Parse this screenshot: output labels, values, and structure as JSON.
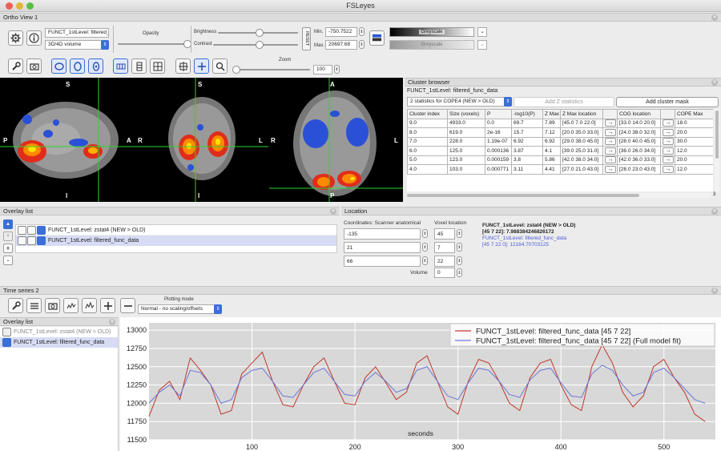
{
  "window": {
    "title": "FSLeyes"
  },
  "ortho": {
    "panel_title": "Ortho View 1",
    "overlay_name": "FUNCT_1stLevel: filtered_func_data",
    "overlay_type": "3D/4D volume",
    "opacity_label": "Opacity",
    "brightness_label": "Brightness",
    "contrast_label": "Contrast",
    "reset_label": "RESET",
    "min_label": "Min.",
    "max_label": "Max.",
    "min_value": "-750.7522",
    "max_value": "20697.68",
    "cmap1": "Greyscale",
    "cmap2": "Greyscale",
    "zoom_label": "Zoom",
    "zoom_value": "100",
    "labels": {
      "sag_top": "S",
      "sag_bottom": "I",
      "sag_left": "P",
      "sag_right": "A",
      "cor_top": "S",
      "cor_bottom": "I",
      "cor_left": "R",
      "cor_right": "L",
      "ax_top": "A",
      "ax_bottom": "P",
      "ax_left": "R",
      "ax_right": "L"
    }
  },
  "cluster": {
    "panel_title": "Cluster browser",
    "overlay_name": "FUNCT_1stLevel: filtered_func_data",
    "selector": "2 statistics for COPE4 (NEW > OLD)",
    "add_z_label": "Add Z statistics",
    "add_mask_label": "Add cluster mask",
    "columns": [
      "Cluster index",
      "Size (voxels)",
      "P",
      "-log10(P)",
      "Z Max",
      "Z Max location",
      "",
      "COG location",
      "",
      "COPE Max"
    ],
    "rows": [
      [
        "9.0",
        "4933.0",
        "0.0",
        "69.7",
        "7.89",
        "[45.0 7.0 22.0]",
        "→",
        "[33.0 14.0 20.0]",
        "→",
        "18.0"
      ],
      [
        "8.0",
        "619.0",
        "2e-16",
        "15.7",
        "7.12",
        "[20.0 35.0 33.0]",
        "→",
        "[24.0 38.0 32.0]",
        "→",
        "20.0"
      ],
      [
        "7.0",
        "228.0",
        "1.19e-07",
        "6.92",
        "6.92",
        "[29.0 38.0 45.0]",
        "→",
        "[28.0 40.0 45.0]",
        "→",
        "30.0"
      ],
      [
        "6.0",
        "125.0",
        "0.000136",
        "3.87",
        "4.1",
        "[39.0 25.0 31.0]",
        "→",
        "[36.0 26.0 34.0]",
        "→",
        "12.0"
      ],
      [
        "5.0",
        "123.0",
        "0.000159",
        "3.8",
        "5.86",
        "[42.0 38.0 34.0]",
        "→",
        "[42.0 36.0 33.0]",
        "→",
        "20.0"
      ],
      [
        "4.0",
        "103.0",
        "0.000771",
        "3.11",
        "4.41",
        "[27.0 21.0 43.0]",
        "→",
        "[28.0 23.0 43.0]",
        "→",
        "12.0"
      ]
    ],
    "scroll_suffix": "3"
  },
  "overlay_list": {
    "panel_title": "Overlay list",
    "items": [
      {
        "name": "FUNCT_1stLevel: zstat4 (NEW > OLD)"
      },
      {
        "name": "FUNCT_1stLevel: filtered_func_data"
      }
    ]
  },
  "location": {
    "panel_title": "Location",
    "coords_label": "Coordinates: Scanner anatomical",
    "voxel_label": "Voxel location",
    "coord_values": [
      "-135",
      "21",
      "66"
    ],
    "voxel_values": [
      "45",
      "7",
      "22"
    ],
    "volume_label": "Volume",
    "volume_value": "0",
    "info_line1": "FUNCT_1stLevel: zstat4 (NEW > OLD)",
    "info_line2": "[45 7 22]: 7.988384246826172",
    "info_line3": "FUNCT_1stLevel: filtered_func_data",
    "info_line4": "[45 7 22 0]: 12164.70703125"
  },
  "timeseries": {
    "panel_title": "Time series 2",
    "plotting_mode_label": "Plotting mode",
    "plotting_mode_value": "Normal - no scaling/offsets",
    "overlay_list_title": "Overlay list",
    "overlay_items": [
      {
        "name": "FUNCT_1stLevel: zstat4 (NEW > OLD)"
      },
      {
        "name": "FUNCT_1stLevel: filtered_func_data"
      }
    ]
  },
  "chart_data": {
    "type": "line",
    "xlabel": "seconds",
    "ylabel": "",
    "xlim": [
      0,
      550
    ],
    "ylim": [
      11500,
      13100
    ],
    "xticks": [
      100,
      200,
      300,
      400,
      500
    ],
    "yticks": [
      11500,
      11750,
      12000,
      12250,
      12500,
      12750,
      13000
    ],
    "grid": true,
    "legend": "top-right",
    "series": [
      {
        "name": "FUNCT_1stLevel: filtered_func_data [45 7 22]",
        "color": "#c0392b",
        "x": [
          0,
          10,
          20,
          30,
          40,
          50,
          60,
          70,
          80,
          90,
          100,
          110,
          120,
          130,
          140,
          150,
          160,
          170,
          180,
          190,
          200,
          210,
          220,
          230,
          240,
          250,
          260,
          270,
          280,
          290,
          300,
          310,
          320,
          330,
          340,
          350,
          360,
          370,
          380,
          390,
          400,
          410,
          420,
          430,
          440,
          450,
          460,
          470,
          480,
          490,
          500,
          510,
          520,
          530,
          540
        ],
        "values": [
          11820,
          12180,
          12300,
          12050,
          12620,
          12450,
          12250,
          11850,
          11900,
          12400,
          12550,
          12700,
          12300,
          11980,
          11950,
          12250,
          12500,
          12620,
          12300,
          12000,
          11980,
          12350,
          12500,
          12280,
          12050,
          12150,
          12550,
          12650,
          12300,
          11950,
          11850,
          12300,
          12600,
          12550,
          12300,
          12000,
          11900,
          12350,
          12550,
          12600,
          12250,
          11980,
          11900,
          12500,
          12800,
          12550,
          12150,
          11950,
          12100,
          12500,
          12600,
          12350,
          12150,
          11850,
          11750
        ]
      },
      {
        "name": "FUNCT_1stLevel: filtered_func_data [45 7 22] (Full model fit)",
        "color": "#6a78d8",
        "x": [
          0,
          10,
          20,
          30,
          40,
          50,
          60,
          70,
          80,
          90,
          100,
          110,
          120,
          130,
          140,
          150,
          160,
          170,
          180,
          190,
          200,
          210,
          220,
          230,
          240,
          250,
          260,
          270,
          280,
          290,
          300,
          310,
          320,
          330,
          340,
          350,
          360,
          370,
          380,
          390,
          400,
          410,
          420,
          430,
          440,
          450,
          460,
          470,
          480,
          490,
          500,
          510,
          520,
          530,
          540
        ],
        "values": [
          12000,
          12150,
          12250,
          12100,
          12450,
          12420,
          12250,
          12000,
          12050,
          12350,
          12450,
          12480,
          12300,
          12100,
          12080,
          12250,
          12420,
          12480,
          12300,
          12120,
          12100,
          12300,
          12420,
          12300,
          12150,
          12200,
          12450,
          12500,
          12300,
          12100,
          12050,
          12280,
          12480,
          12450,
          12300,
          12120,
          12080,
          12320,
          12450,
          12480,
          12280,
          12100,
          12080,
          12400,
          12520,
          12450,
          12250,
          12100,
          12150,
          12420,
          12480,
          12350,
          12200,
          12050,
          12000
        ]
      }
    ]
  }
}
